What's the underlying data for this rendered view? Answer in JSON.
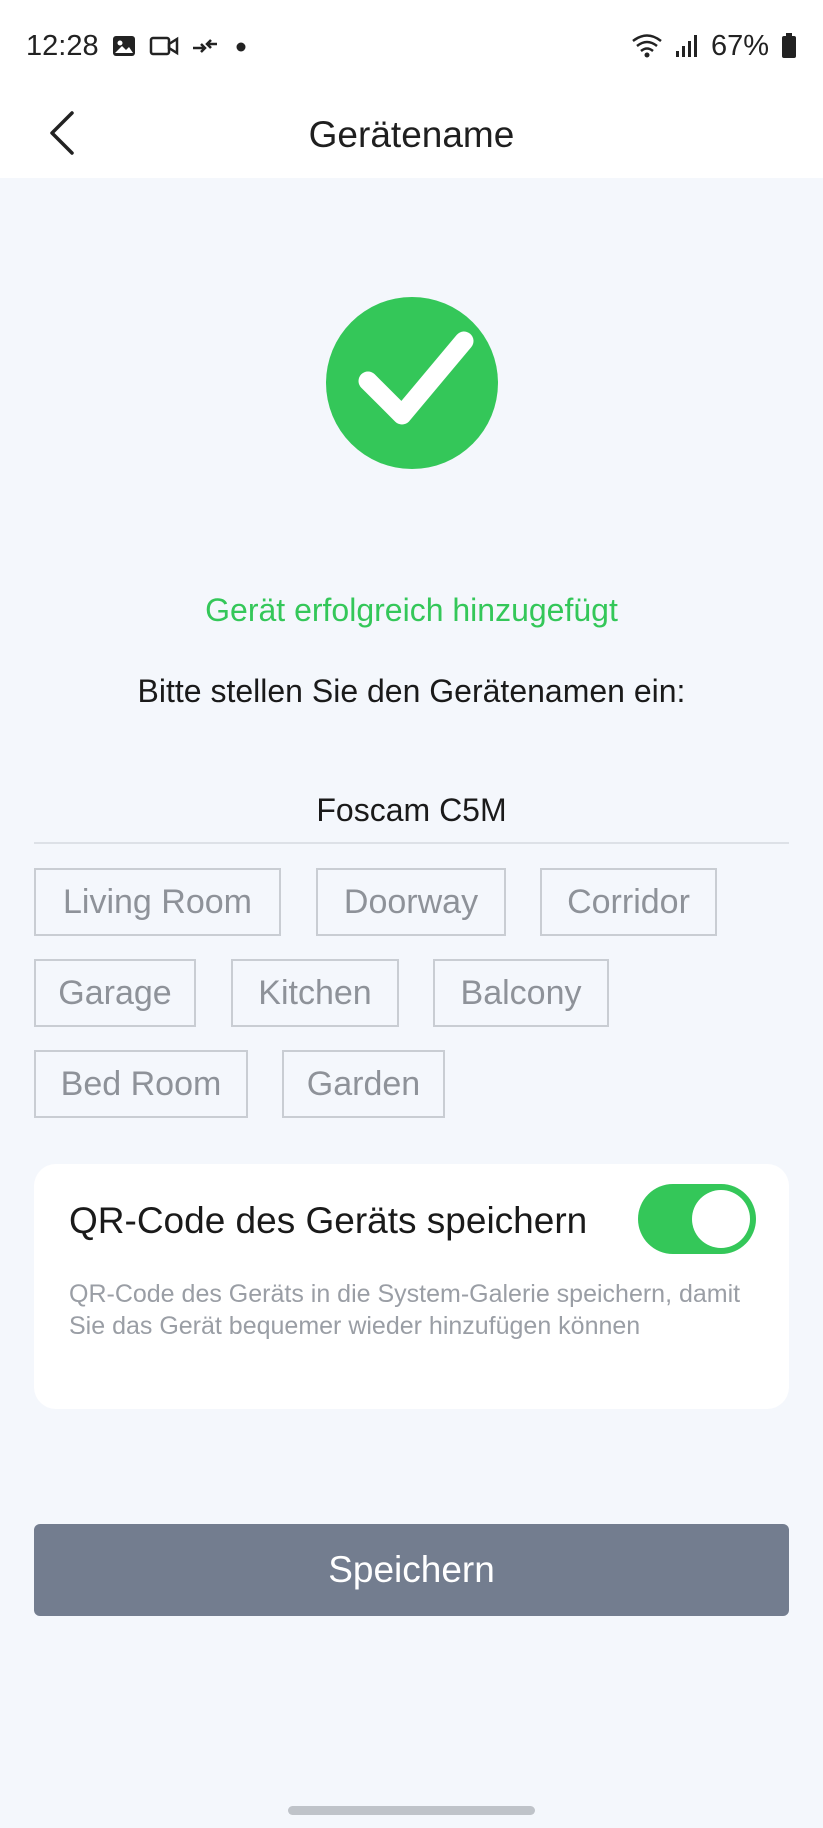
{
  "status_bar": {
    "time": "12:28",
    "battery": "67%",
    "icons": [
      "image-icon",
      "video-icon",
      "data-transfer-icon",
      "dot-icon",
      "wifi-icon",
      "signal-icon",
      "battery-icon"
    ]
  },
  "header": {
    "title": "Gerätename",
    "back_icon": "chevron-left-icon"
  },
  "main": {
    "success_icon": "check-circle-icon",
    "success_color": "#34c759",
    "success_text": "Gerät erfolgreich hinzugefügt",
    "prompt_text": "Bitte stellen Sie den Gerätenamen ein:",
    "name_input": {
      "value": "Foscam C5M",
      "placeholder": ""
    },
    "tags": [
      {
        "label": "Living Room"
      },
      {
        "label": "Doorway"
      },
      {
        "label": "Corridor"
      },
      {
        "label": "Garage"
      },
      {
        "label": "Kitchen"
      },
      {
        "label": "Balcony"
      },
      {
        "label": "Bed Room"
      },
      {
        "label": "Garden"
      }
    ]
  },
  "qr_card": {
    "title": "QR-Code des Geräts speichern",
    "toggle_on": true,
    "toggle_color": "#34c759",
    "description": "QR-Code des Geräts in die System-Galerie speichern, damit Sie das Gerät bequemer wieder hinzufügen können"
  },
  "save_button": {
    "label": "Speichern",
    "color": "#737d8f"
  }
}
